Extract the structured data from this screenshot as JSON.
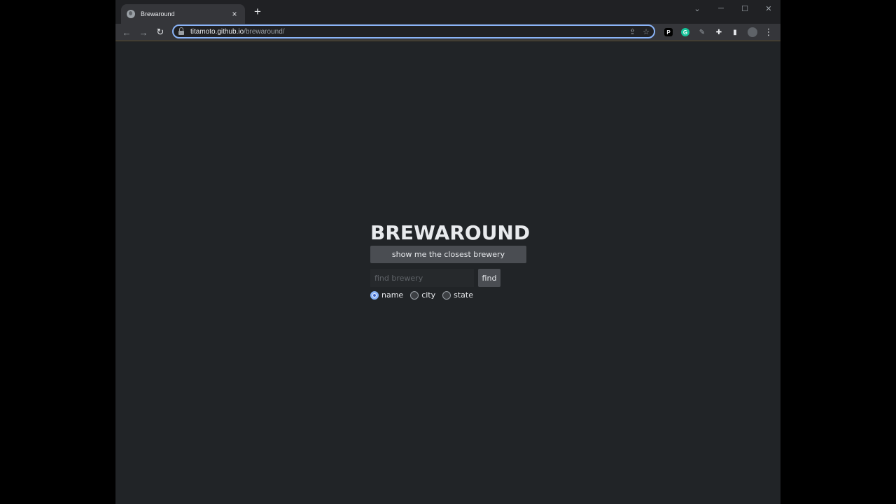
{
  "browser": {
    "tab_title": "Brewaround",
    "tab_close": "×",
    "new_tab": "+",
    "url_host": "titamoto.github.io",
    "url_path": "/brewaround/",
    "window_controls": {
      "minimize": "─",
      "maximize": "☐",
      "close": "✕",
      "dropdown": "⌄"
    },
    "nav": {
      "back": "←",
      "forward": "→",
      "reload": "↻"
    },
    "omnibox_icons": {
      "share": "⇪",
      "star": "☆"
    },
    "extensions": {
      "p_label": "P",
      "g_label": "G",
      "puzzle": "✚",
      "sidepanel": "▮",
      "menu": "⋮"
    }
  },
  "app": {
    "title": "BREWAROUND",
    "closest_button": "show me the closest brewery",
    "search": {
      "placeholder": "find brewery",
      "value": ""
    },
    "find_button": "find",
    "search_by": {
      "options": [
        {
          "label": "name",
          "checked": true
        },
        {
          "label": "city",
          "checked": false
        },
        {
          "label": "state",
          "checked": false
        }
      ]
    }
  },
  "colors": {
    "page_bg": "#212427",
    "accent": "#8ab4f8",
    "button_bg": "#4a4d52"
  }
}
